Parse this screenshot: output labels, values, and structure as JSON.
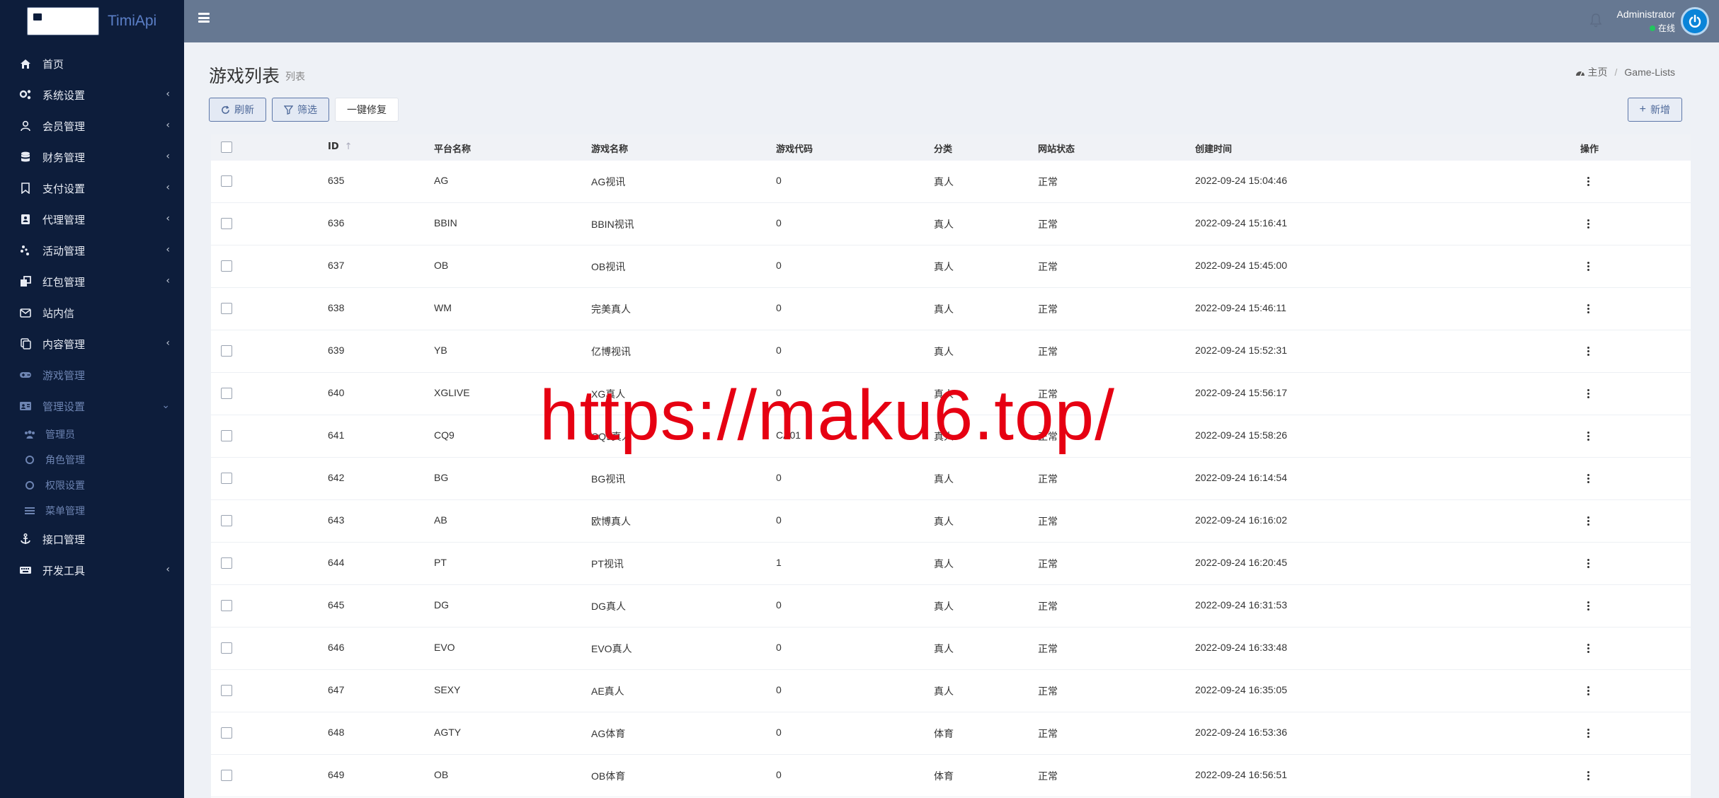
{
  "brand": {
    "name": "TimiApi"
  },
  "sidebar": {
    "items": [
      {
        "label": "首页",
        "icon": "home-icon",
        "arrow": ""
      },
      {
        "label": "系统设置",
        "icon": "cogs-icon",
        "arrow": "‹"
      },
      {
        "label": "会员管理",
        "icon": "user-icon",
        "arrow": "‹"
      },
      {
        "label": "财务管理",
        "icon": "database-icon",
        "arrow": "‹"
      },
      {
        "label": "支付设置",
        "icon": "bookmark-icon",
        "arrow": "‹"
      },
      {
        "label": "代理管理",
        "icon": "contact-book-icon",
        "arrow": "‹"
      },
      {
        "label": "活动管理",
        "icon": "activity-icon",
        "arrow": "‹"
      },
      {
        "label": "红包管理",
        "icon": "redpacket-icon",
        "arrow": "‹"
      },
      {
        "label": "站内信",
        "icon": "mail-icon",
        "arrow": ""
      },
      {
        "label": "内容管理",
        "icon": "copy-icon",
        "arrow": "‹"
      },
      {
        "label": "游戏管理",
        "icon": "gamepad-icon",
        "arrow": ""
      },
      {
        "label": "管理设置",
        "icon": "id-card-icon",
        "arrow": "⌄"
      }
    ],
    "sub_items": [
      {
        "label": "管理员",
        "icon": "users-icon"
      },
      {
        "label": "角色管理",
        "icon": "circle-icon"
      },
      {
        "label": "权限设置",
        "icon": "circle-icon"
      },
      {
        "label": "菜单管理",
        "icon": "list-icon"
      }
    ],
    "bottom_items": [
      {
        "label": "接口管理",
        "icon": "anchor-icon",
        "arrow": ""
      },
      {
        "label": "开发工具",
        "icon": "keyboard-icon",
        "arrow": "‹"
      }
    ]
  },
  "header": {
    "user_name": "Administrator",
    "user_status": "在线"
  },
  "page": {
    "title": "游戏列表",
    "subtitle": "列表",
    "breadcrumb": [
      "主页",
      "Game-Lists"
    ]
  },
  "toolbar": {
    "refresh": "刷新",
    "filter": "筛选",
    "repair": "一键修复",
    "add": "新增"
  },
  "table": {
    "columns": [
      "ID",
      "平台名称",
      "游戏名称",
      "游戏代码",
      "分类",
      "网站状态",
      "创建时间",
      "操作"
    ],
    "rows": [
      [
        "635",
        "AG",
        "AG视讯",
        "0",
        "真人",
        "正常",
        "2022-09-24 15:04:46"
      ],
      [
        "636",
        "BBIN",
        "BBIN视讯",
        "0",
        "真人",
        "正常",
        "2022-09-24 15:16:41"
      ],
      [
        "637",
        "OB",
        "OB视讯",
        "0",
        "真人",
        "正常",
        "2022-09-24 15:45:00"
      ],
      [
        "638",
        "WM",
        "完美真人",
        "0",
        "真人",
        "正常",
        "2022-09-24 15:46:11"
      ],
      [
        "639",
        "YB",
        "亿博视讯",
        "0",
        "真人",
        "正常",
        "2022-09-24 15:52:31"
      ],
      [
        "640",
        "XGLIVE",
        "XG真人",
        "0",
        "真人",
        "正常",
        "2022-09-24 15:56:17"
      ],
      [
        "641",
        "CQ9",
        "CQ9真人",
        "CA01",
        "真人",
        "正常",
        "2022-09-24 15:58:26"
      ],
      [
        "642",
        "BG",
        "BG视讯",
        "0",
        "真人",
        "正常",
        "2022-09-24 16:14:54"
      ],
      [
        "643",
        "AB",
        "欧博真人",
        "0",
        "真人",
        "正常",
        "2022-09-24 16:16:02"
      ],
      [
        "644",
        "PT",
        "PT视讯",
        "1",
        "真人",
        "正常",
        "2022-09-24 16:20:45"
      ],
      [
        "645",
        "DG",
        "DG真人",
        "0",
        "真人",
        "正常",
        "2022-09-24 16:31:53"
      ],
      [
        "646",
        "EVO",
        "EVO真人",
        "0",
        "真人",
        "正常",
        "2022-09-24 16:33:48"
      ],
      [
        "647",
        "SEXY",
        "AE真人",
        "0",
        "真人",
        "正常",
        "2022-09-24 16:35:05"
      ],
      [
        "648",
        "AGTY",
        "AG体育",
        "0",
        "体育",
        "正常",
        "2022-09-24 16:53:36"
      ],
      [
        "649",
        "OB",
        "OB体育",
        "0",
        "体育",
        "正常",
        "2022-09-24 16:56:51"
      ]
    ]
  },
  "watermark": "https://maku6.top/",
  "colors": {
    "sidebar_bg": "#0d1d3b",
    "topbar_bg": "#667892",
    "accent": "#5d77a8",
    "watermark": "#e60012"
  }
}
